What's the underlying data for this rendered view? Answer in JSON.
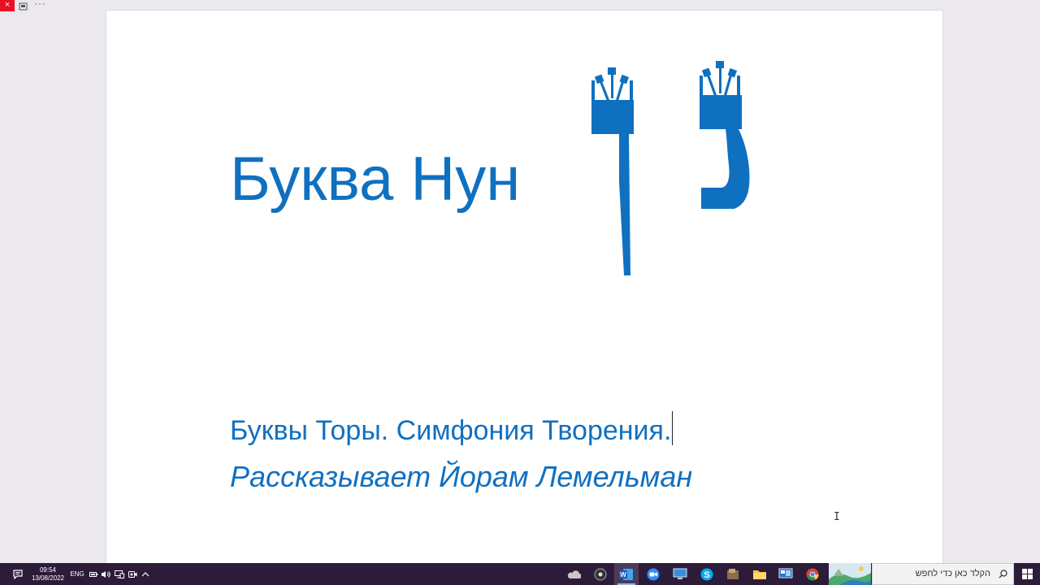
{
  "window": {
    "close_glyph": "×",
    "more_glyph": "···"
  },
  "document": {
    "title": "Буква Нун",
    "subtitle": "Буквы Торы. Симфония Творения.",
    "narrator": "Рассказывает Йорам Лемельман",
    "text_color": "#1070c0",
    "letters": [
      "final-nun",
      "nun"
    ]
  },
  "taskbar": {
    "time": "09:54",
    "date": "13/08/2022",
    "language": "ENG",
    "tray_icons": [
      "battery-icon",
      "volume-icon",
      "network-icon",
      "meet-now-icon",
      "show-hidden-icons-chevron"
    ],
    "apps": [
      "onedrive-icon",
      "media-player-icon",
      "word-icon",
      "zoom-icon",
      "remote-desktop-icon",
      "skype-icon",
      "file-manager-icon",
      "file-explorer-icon",
      "control-panel-icon",
      "chrome-icon"
    ],
    "search_placeholder": "הקלד כאן כדי לחפש",
    "background_color": "#2c1c3a"
  }
}
